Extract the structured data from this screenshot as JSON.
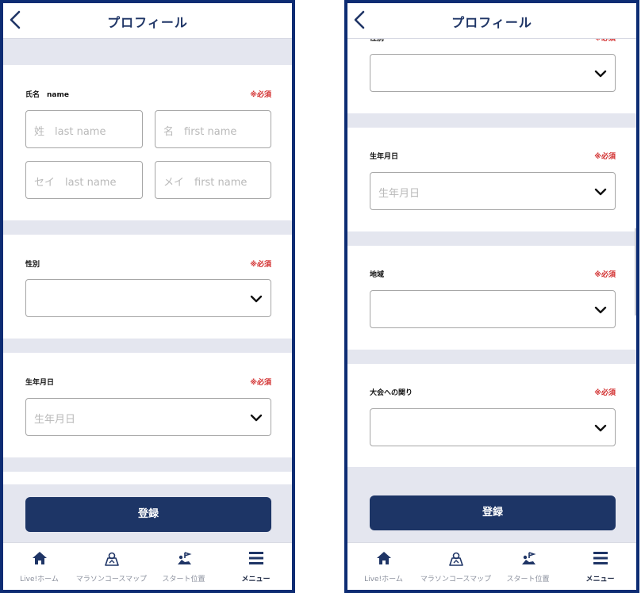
{
  "header": {
    "title": "プロフィール"
  },
  "form": {
    "required": "※必須",
    "name_label": "氏名　name",
    "last_name_placeholder": "姓　last name",
    "first_name_placeholder": "名　first name",
    "last_kana_placeholder": "セイ　last name",
    "first_kana_placeholder": "メイ　first name",
    "gender_label": "性別",
    "gender_label_partial": "性別",
    "gender_value": "",
    "birthdate_label": "生年月日",
    "birthdate_placeholder": "生年月日",
    "region_label": "地域",
    "region_value": "",
    "relation_label": "大会への関り",
    "relation_value": "",
    "submit_label": "登録"
  },
  "tabbar": {
    "items": [
      {
        "label": "Live!ホーム",
        "icon": "home-icon",
        "active": false
      },
      {
        "label": "マラソンコースマップ",
        "icon": "map-icon",
        "active": false
      },
      {
        "label": "スタート位置",
        "icon": "start-position-icon",
        "active": false
      },
      {
        "label": "メニュー",
        "icon": "menu-icon",
        "active": true
      }
    ]
  },
  "colors": {
    "frame": "#0d2c73",
    "primary": "#1d3566",
    "required": "#d12a2a",
    "band": "#e4e6ef"
  }
}
